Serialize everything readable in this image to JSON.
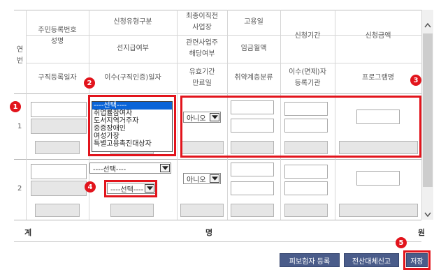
{
  "header": {
    "row_no": "연\n번",
    "col1_top": "주민등록번호\n성명",
    "col2_top": "신청유형구분",
    "col2_mid": "선지급여부",
    "col3_top": "최종이직전\n사업장",
    "col3_mid": "관련사업주\n해당여부",
    "col4_top": "고용일",
    "col4_mid": "임금월액",
    "col5_top": "신청기간",
    "col6_top": "신청금액",
    "col1_bot": "구직등록일자",
    "col2_bot": "이수(구직인증)일자",
    "col3_bot": "유효기간\n만료일",
    "col4_bot": "취약계층분류",
    "col5_bot": "이수(면제)자\n등록기관",
    "col6_bot": "프로그램명"
  },
  "rows": [
    {
      "number": "1",
      "valid_select": "아니오"
    },
    {
      "number": "2",
      "type_select": "----선택----",
      "prepay_select": "----선택----",
      "valid_select": "아니오"
    }
  ],
  "listbox_options": [
    "----선택----",
    "취업률참여자",
    "도서지역거주자",
    "중증장애인",
    "여성가장",
    "특별고용촉진대상자"
  ],
  "footer": {
    "total": "계",
    "people_unit": "명",
    "won_unit": "원"
  },
  "buttons": {
    "insured_register": "피보험자 등록",
    "electronic_report": "전산대체신고",
    "save": "저장"
  },
  "badges": [
    "1",
    "2",
    "3",
    "4",
    "5"
  ],
  "colors": {
    "accent_red": "#e2141c",
    "button_bg": "#4a5c8a",
    "selected_option": "#0a64d8"
  }
}
